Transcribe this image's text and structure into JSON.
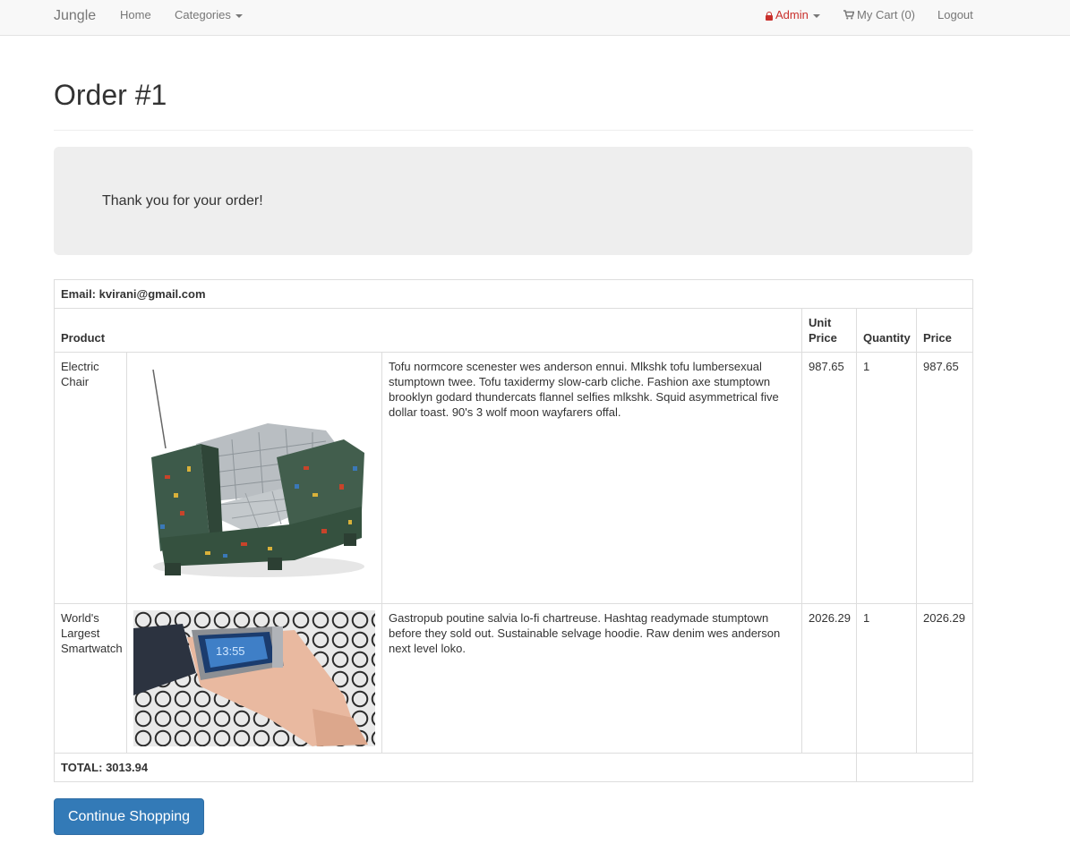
{
  "navbar": {
    "brand": "Jungle",
    "home": "Home",
    "categories": "Categories",
    "admin": "Admin",
    "cart": "My Cart (0)",
    "logout": "Logout"
  },
  "page": {
    "title": "Order #1",
    "thank_you": "Thank you for your order!"
  },
  "order": {
    "email_label": "Email: kvirani@gmail.com",
    "headers": {
      "product": "Product",
      "unit_price": "Unit Price",
      "quantity": "Quantity",
      "price": "Price"
    },
    "items": [
      {
        "name": "Electric Chair",
        "description": "Tofu normcore scenester wes anderson ennui. Mlkshk tofu lumbersexual stumptown twee. Tofu taxidermy slow-carb cliche. Fashion axe stumptown brooklyn godard thundercats flannel selfies mlkshk. Squid asymmetrical five dollar toast. 90's 3 wolf moon wayfarers offal.",
        "unit_price": "987.65",
        "quantity": "1",
        "price": "987.65"
      },
      {
        "name": "World's Largest Smartwatch",
        "description": "Gastropub poutine salvia lo-fi chartreuse. Hashtag readymade stumptown before they sold out. Sustainable selvage hoodie. Raw denim wes anderson next level loko.",
        "unit_price": "2026.29",
        "quantity": "1",
        "price": "2026.29"
      }
    ],
    "total_label": "TOTAL: 3013.94"
  },
  "actions": {
    "continue_shopping": "Continue Shopping"
  },
  "colors": {
    "primary_button": "#337ab7",
    "admin_link": "#c9302c",
    "jumbotron_bg": "#eeeeee"
  },
  "icons": {
    "admin": "lock-icon",
    "cart": "shopping-cart-icon",
    "dropdown": "caret-down-icon"
  }
}
